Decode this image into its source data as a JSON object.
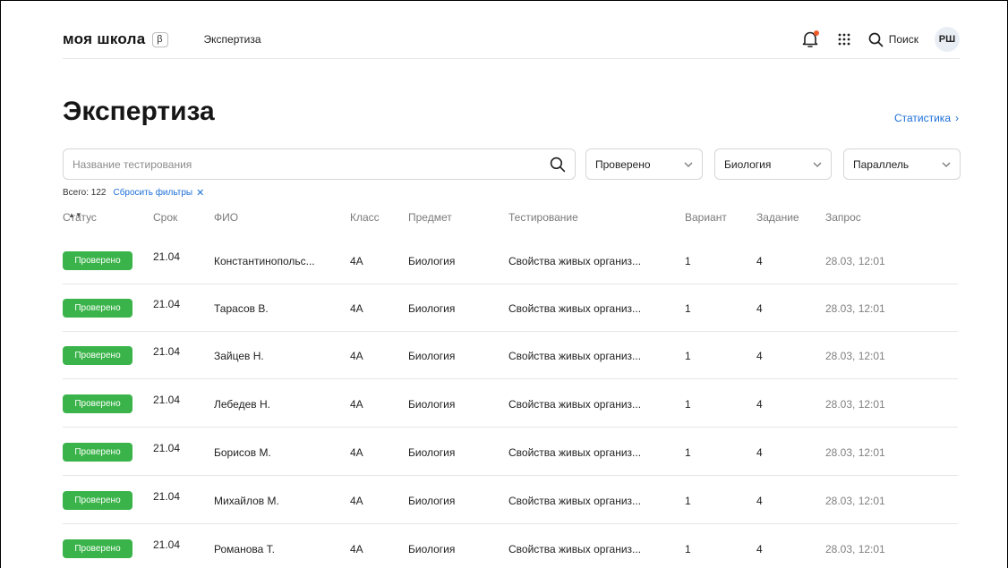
{
  "header": {
    "logo": "моя школа",
    "beta": "β",
    "nav_link": "Экспертиза",
    "search_label": "Поиск",
    "avatar_initials": "РШ",
    "notification_dot_color": "#f05a28",
    "icons": [
      "bell-icon",
      "apps-grid-icon",
      "search-icon"
    ]
  },
  "page": {
    "title": "Экспертиза",
    "stats_link": "Статистика",
    "stats_chevron": "›"
  },
  "filters": {
    "search_placeholder": "Название тестирования",
    "status_select": "Проверено",
    "subject_select": "Биология",
    "grade_select": "Параллель"
  },
  "summary": {
    "total": "Всего: 122",
    "reset_label": "Сбросить фильтры",
    "reset_icon": "✕"
  },
  "table": {
    "headers": {
      "status": "Статус",
      "date": "Срок",
      "fio": "ФИО",
      "class": "Класс",
      "subject": "Предмет",
      "test": "Тестирование",
      "variant": "Вариант",
      "task": "Задание",
      "request": "Запрос"
    },
    "badge_color": "#3ab44a",
    "rows": [
      {
        "status": "Проверено",
        "date": "21.04",
        "fio": "Константинопольс...",
        "class": "4А",
        "subject": "Биология",
        "test": "Свойства живых организ...",
        "variant": "1",
        "task": "4",
        "request": "28.03, 12:01"
      },
      {
        "status": "Проверено",
        "date": "21.04",
        "fio": "Тарасов В.",
        "class": "4А",
        "subject": "Биология",
        "test": "Свойства живых организ...",
        "variant": "1",
        "task": "4",
        "request": "28.03, 12:01"
      },
      {
        "status": "Проверено",
        "date": "21.04",
        "fio": "Зайцев Н.",
        "class": "4А",
        "subject": "Биология",
        "test": "Свойства живых организ...",
        "variant": "1",
        "task": "4",
        "request": "28.03, 12:01"
      },
      {
        "status": "Проверено",
        "date": "21.04",
        "fio": "Лебедев Н.",
        "class": "4А",
        "subject": "Биология",
        "test": "Свойства живых организ...",
        "variant": "1",
        "task": "4",
        "request": "28.03, 12:01"
      },
      {
        "status": "Проверено",
        "date": "21.04",
        "fio": "Борисов М.",
        "class": "4А",
        "subject": "Биология",
        "test": "Свойства живых организ...",
        "variant": "1",
        "task": "4",
        "request": "28.03, 12:01"
      },
      {
        "status": "Проверено",
        "date": "21.04",
        "fio": "Михайлов М.",
        "class": "4А",
        "subject": "Биология",
        "test": "Свойства живых организ...",
        "variant": "1",
        "task": "4",
        "request": "28.03, 12:01"
      },
      {
        "status": "Проверено",
        "date": "21.04",
        "fio": "Романова Т.",
        "class": "4А",
        "subject": "Биология",
        "test": "Свойства живых организ...",
        "variant": "1",
        "task": "4",
        "request": "28.03, 12:01"
      }
    ]
  }
}
